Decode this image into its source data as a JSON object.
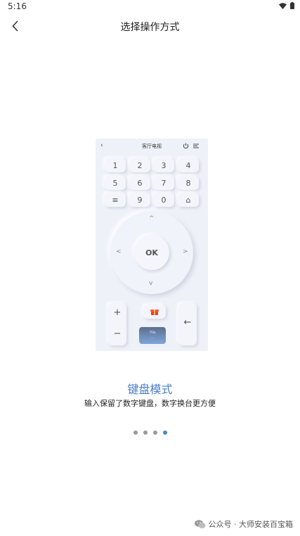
{
  "status_bar": {
    "time": "5:16"
  },
  "header": {
    "title": "选择操作方式"
  },
  "preview": {
    "title": "客厅电视",
    "keypad": [
      "1",
      "2",
      "3",
      "4",
      "5",
      "6",
      "7",
      "8",
      "≡",
      "9",
      "0",
      "⌂"
    ],
    "ok_label": "OK",
    "plus_label": "+",
    "minus_label": "−",
    "back_label": "←",
    "thumb_line1": "75%",
    "thumb_line2": "...",
    "dpad": {
      "up": "^",
      "down": "v",
      "left": "<",
      "right": ">"
    }
  },
  "mode": {
    "title": "键盘模式",
    "description": "输入保留了数字键盘，数字换台更方便"
  },
  "pager": {
    "count": 4,
    "active_index": 3
  },
  "watermark": {
    "text": "公众号 · 大师安装百宝箱"
  },
  "colors": {
    "accent": "#4a7cc9",
    "dot_inactive": "#9a9a9a",
    "dot_active": "#4a86c9"
  }
}
